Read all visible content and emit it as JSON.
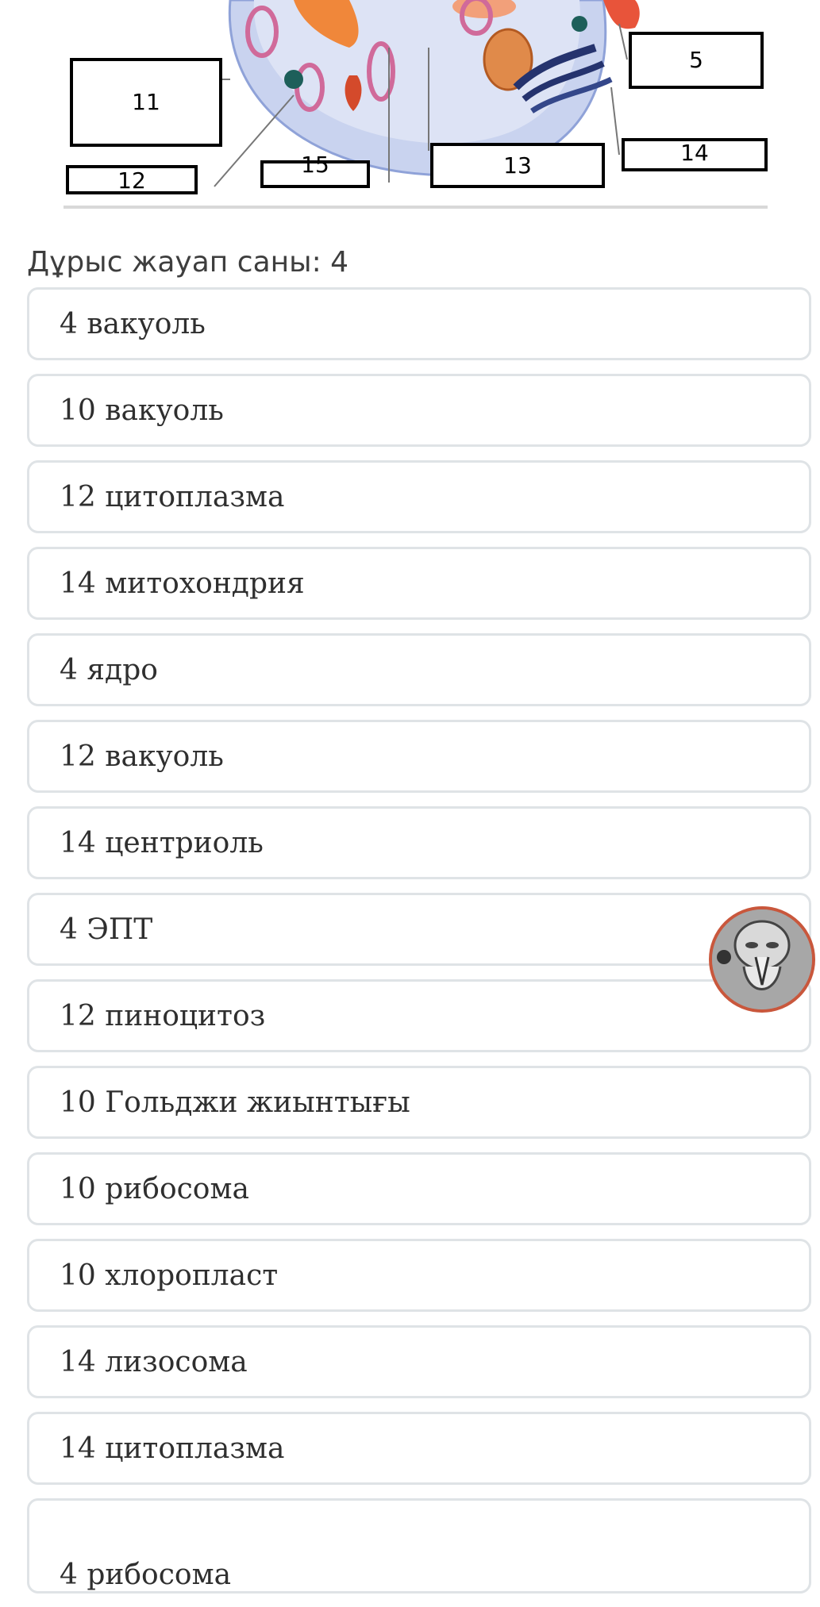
{
  "diagram": {
    "labels": [
      "5",
      "11",
      "12",
      "15",
      "13",
      "14"
    ]
  },
  "answer_count_text": "Дұрыс жауап саны: 4",
  "options": [
    "4 вакуоль",
    "10 вакуоль",
    "12 цитоплазма",
    "14 митохондрия",
    "4 ядро",
    "12 вакуоль",
    "14 центриоль",
    "4 ЭПТ",
    "12 пиноцитоз",
    "10 Гольджи жиынтығы",
    "10 рибосома",
    "10 хлоропласт",
    "14 лизосома",
    "14 цитоплазма",
    "4 рибосома"
  ],
  "colors": {
    "option_border": "#dfe3e6",
    "text": "#2f2f2f",
    "avatar_ring": "#c9573c"
  }
}
